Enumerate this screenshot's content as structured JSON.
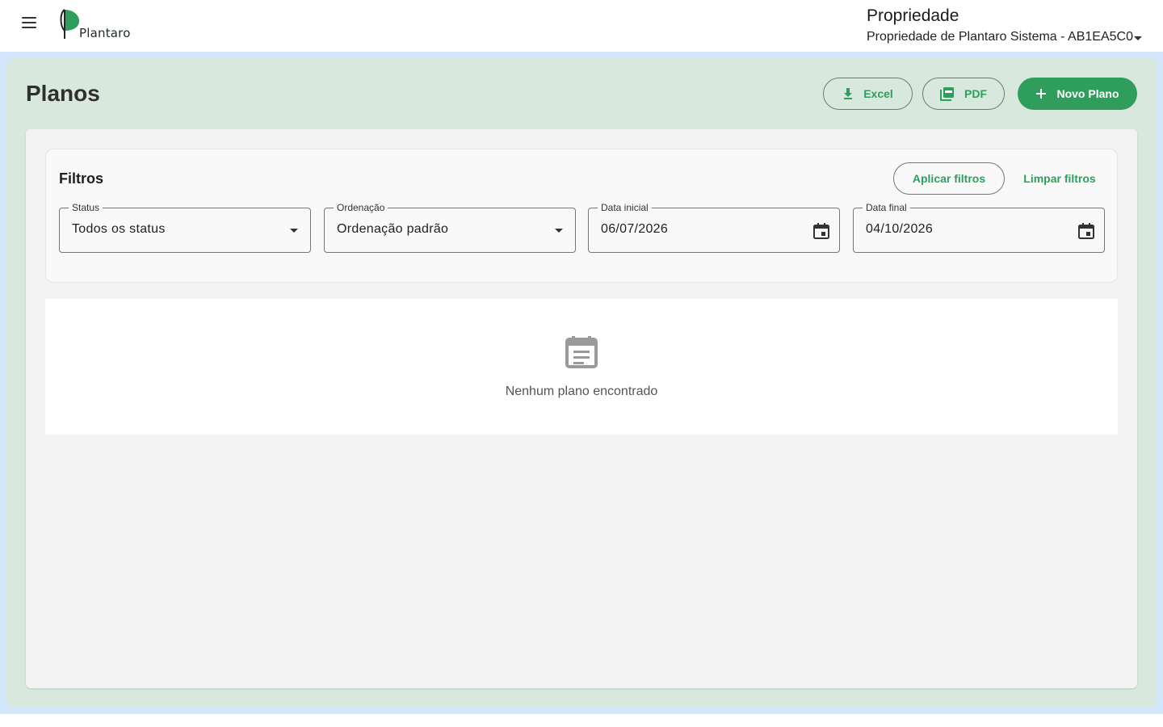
{
  "app": {
    "logo_text": "Plantaro"
  },
  "header": {
    "property_title": "Propriedade",
    "property_selected": "Propriedade de Plantaro Sistema - AB1EA5C0"
  },
  "page": {
    "title": "Planos"
  },
  "toolbar": {
    "excel_label": "Excel",
    "pdf_label": "PDF",
    "new_plan_label": "Novo Plano"
  },
  "filters": {
    "title": "Filtros",
    "apply_label": "Aplicar filtros",
    "clear_label": "Limpar filtros",
    "status": {
      "label": "Status",
      "value": "Todos os status"
    },
    "ordering": {
      "label": "Ordenação",
      "value": "Ordenação padrão"
    },
    "start_date": {
      "label": "Data inicial",
      "value": "06/07/2026"
    },
    "end_date": {
      "label": "Data final",
      "value": "04/10/2026"
    }
  },
  "empty_state": {
    "message": "Nenhum plano encontrado"
  },
  "colors": {
    "accent": "#2f9e5d",
    "frame": "#d4e6fb",
    "panel": "#d9e8dc"
  },
  "icons": {
    "menu": "menu-icon",
    "download": "download-icon",
    "pdf": "pdf-icon",
    "add": "add-icon",
    "calendar": "calendar-icon",
    "empty": "event-note-icon"
  }
}
